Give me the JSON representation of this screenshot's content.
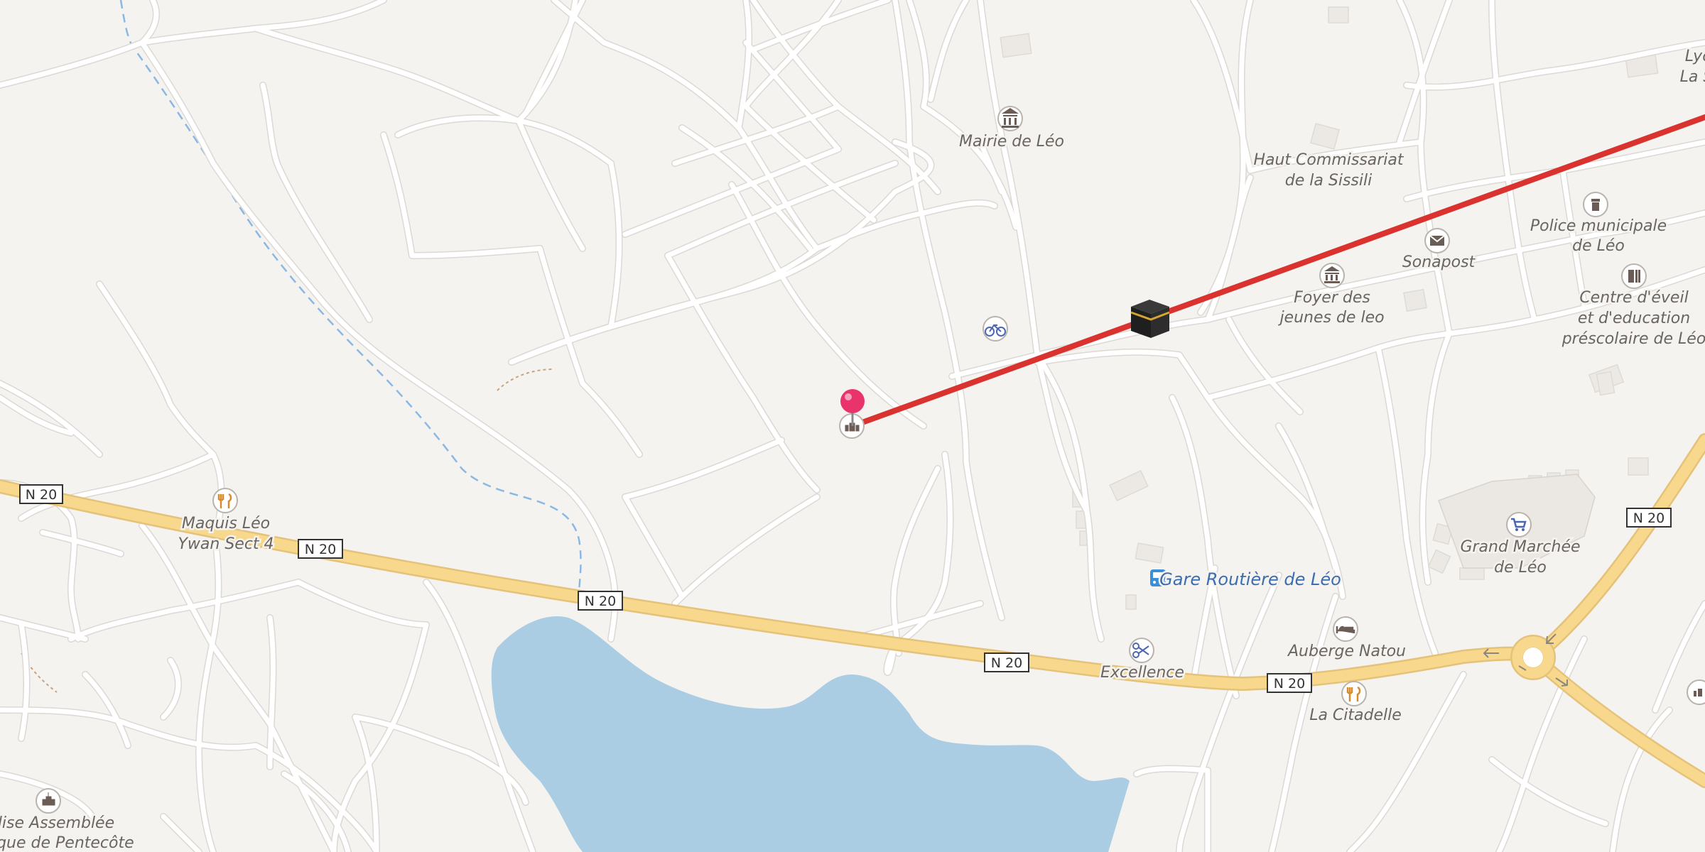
{
  "map": {
    "route_color": "#d9322f",
    "road_major_color": "#f8d88c",
    "water_color": "#aacde3",
    "pin_color": "#e8336b",
    "shields": [
      "N 20",
      "N 20",
      "N 20",
      "N 20",
      "N 20",
      "N 20"
    ],
    "labels": {
      "mairie": "Mairie de Léo",
      "haut1": "Haut Commissariat",
      "haut2": "de la Sissili",
      "police1": "Police municipale",
      "police2": "de Léo",
      "sonapost": "Sonapost",
      "foyer1": "Foyer des",
      "foyer2": "jeunes de leo",
      "centre1": "Centre d'éveil",
      "centre2": "et d'education",
      "centre3": "préscolaire de Léo",
      "lyc1": "Lyc",
      "lyc2": "La S",
      "maquis1": "Maquis Léo",
      "maquis2": "Ywan Sect 4",
      "gare": "Gare Routière de Léo",
      "grand1": "Grand Marchée",
      "grand2": "de Léo",
      "auberge": "Auberge Natou",
      "excellence": "Excellence",
      "citadelle": "La Citadelle",
      "eglise1": "glise Assemblée",
      "eglise2": "gelique de Pentecôte"
    },
    "icons": {
      "mairie": "town-hall-icon",
      "police": "police-icon",
      "sonapost": "post-office-icon",
      "foyer": "community-centre-icon",
      "centre": "kindergarten-icon",
      "bicycle": "bicycle-rental-icon",
      "kaaba": "kaaba-icon",
      "mosque": "place-of-worship-icon",
      "maquis": "restaurant-icon",
      "gare": "bus-station-icon",
      "grand": "marketplace-icon",
      "auberge": "hotel-icon",
      "excellence": "hairdresser-icon",
      "citadelle": "restaurant-icon",
      "eglise": "church-icon"
    }
  }
}
